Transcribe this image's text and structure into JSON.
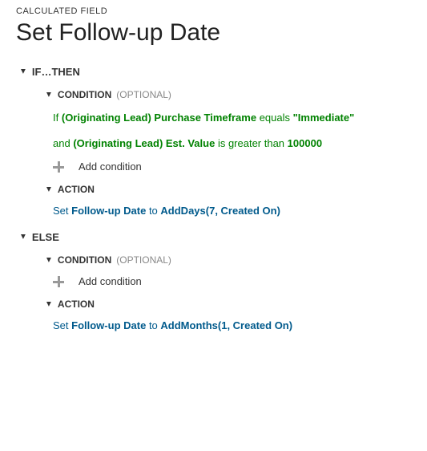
{
  "header": {
    "type_label": "CALCULATED FIELD",
    "title": "Set Follow-up Date"
  },
  "ifthen": {
    "label": "IF…THEN",
    "condition": {
      "label": "CONDITION",
      "optional": "(OPTIONAL)",
      "rows": [
        {
          "prefix": "If",
          "field": "(Originating Lead) Purchase Timeframe",
          "op": "equals",
          "value": "\"Immediate\""
        },
        {
          "prefix": "and",
          "field": "(Originating Lead) Est. Value",
          "op": "is greater than",
          "value": "100000"
        }
      ],
      "add_label": "Add condition"
    },
    "action": {
      "label": "ACTION",
      "set": "Set",
      "field": "Follow-up Date",
      "to": "to",
      "fn": "AddDays(7, Created On)"
    }
  },
  "else": {
    "label": "ELSE",
    "condition": {
      "label": "CONDITION",
      "optional": "(OPTIONAL)",
      "add_label": "Add condition"
    },
    "action": {
      "label": "ACTION",
      "set": "Set",
      "field": "Follow-up Date",
      "to": "to",
      "fn": "AddMonths(1, Created On)"
    }
  }
}
